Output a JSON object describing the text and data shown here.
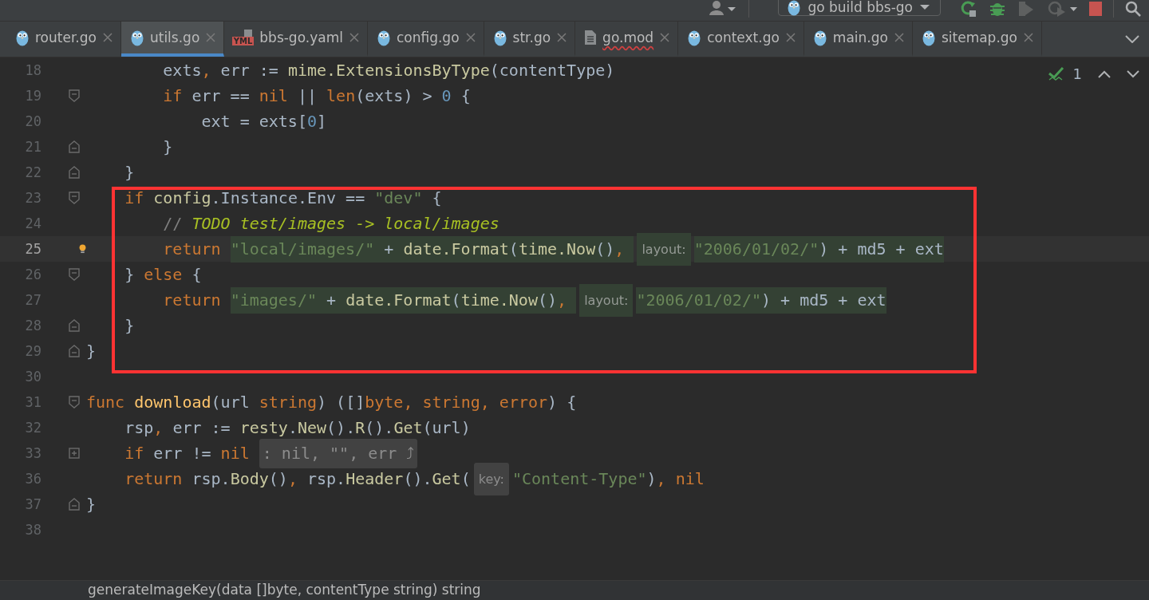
{
  "toolbar": {
    "run_config": "go build bbs-go"
  },
  "tabs": [
    {
      "label": "router.go",
      "kind": "go",
      "selected": false,
      "error": false
    },
    {
      "label": "utils.go",
      "kind": "go",
      "selected": true,
      "error": false
    },
    {
      "label": "bbs-go.yaml",
      "kind": "yaml",
      "icon_text": "YML",
      "selected": false,
      "error": false
    },
    {
      "label": "config.go",
      "kind": "go",
      "selected": false,
      "error": false
    },
    {
      "label": "str.go",
      "kind": "go",
      "selected": false,
      "error": false
    },
    {
      "label": "go.mod",
      "kind": "mod",
      "selected": false,
      "error": true
    },
    {
      "label": "context.go",
      "kind": "go",
      "selected": false,
      "error": false
    },
    {
      "label": "main.go",
      "kind": "go",
      "selected": false,
      "error": false
    },
    {
      "label": "sitemap.go",
      "kind": "go",
      "selected": false,
      "error": false
    }
  ],
  "inspection": {
    "count": "1"
  },
  "lines": [
    {
      "number": "18",
      "current": false,
      "tokens": [
        {
          "kind": "id",
          "text": "        exts"
        },
        {
          "kind": "punct",
          "text": ", "
        },
        {
          "kind": "id",
          "text": "err := "
        },
        {
          "kind": "call",
          "text": "mime.ExtensionsByType"
        },
        {
          "kind": "id",
          "text": "(contentType)"
        }
      ]
    },
    {
      "number": "19",
      "current": false,
      "fold": {
        "kind": "open"
      },
      "tokens": [
        {
          "kind": "kw",
          "text": "        if "
        },
        {
          "kind": "id",
          "text": "err == "
        },
        {
          "kind": "kw",
          "text": "nil"
        },
        {
          "kind": "id",
          "text": " || "
        },
        {
          "kind": "kw",
          "text": "len"
        },
        {
          "kind": "id",
          "text": "(exts) > "
        },
        {
          "kind": "num",
          "text": "0"
        },
        {
          "kind": "id",
          "text": " {"
        }
      ]
    },
    {
      "number": "20",
      "current": false,
      "tokens": [
        {
          "kind": "id",
          "text": "            ext = exts["
        },
        {
          "kind": "num",
          "text": "0"
        },
        {
          "kind": "id",
          "text": "]"
        }
      ]
    },
    {
      "number": "21",
      "current": false,
      "fold": {
        "kind": "close"
      },
      "tokens": [
        {
          "kind": "id",
          "text": "        }"
        }
      ]
    },
    {
      "number": "22",
      "current": false,
      "fold": {
        "kind": "close"
      },
      "tokens": [
        {
          "kind": "id",
          "text": "    }"
        }
      ]
    },
    {
      "number": "23",
      "current": false,
      "fold": {
        "kind": "open"
      },
      "tokens": [
        {
          "kind": "kw",
          "text": "    if "
        },
        {
          "kind": "call",
          "text": "config"
        },
        {
          "kind": "id",
          "text": ".Instance.Env == "
        },
        {
          "kind": "str",
          "text": "\"dev\""
        },
        {
          "kind": "id",
          "text": " {"
        }
      ]
    },
    {
      "number": "24",
      "current": false,
      "tokens": [
        {
          "kind": "cmt",
          "text": "        // "
        },
        {
          "kind": "todo",
          "text": "TODO test/images -> local/images"
        }
      ]
    },
    {
      "number": "25",
      "current": true,
      "bulb": true,
      "tokens": [
        {
          "kind": "kw",
          "text": "        return "
        },
        {
          "kind": "str",
          "text": "\"local/images/\"",
          "marked": true
        },
        {
          "kind": "id",
          "text": " + ",
          "marked": true
        },
        {
          "kind": "call",
          "text": "date.Format",
          "marked": true
        },
        {
          "kind": "id",
          "text": "(",
          "marked": true
        },
        {
          "kind": "call",
          "text": "time.Now",
          "marked": true
        },
        {
          "kind": "id",
          "text": "()",
          "marked": true
        },
        {
          "kind": "punct",
          "text": ", ",
          "marked": true
        },
        {
          "kind": "hint",
          "text": "layout:",
          "marked": true
        },
        {
          "kind": "str",
          "text": "\"2006/01/02/\"",
          "marked": true
        },
        {
          "kind": "id",
          "text": ") + md5 + ext",
          "marked": true
        }
      ]
    },
    {
      "number": "26",
      "current": false,
      "fold": {
        "kind": "open"
      },
      "tokens": [
        {
          "kind": "id",
          "text": "    } "
        },
        {
          "kind": "kw",
          "text": "else"
        },
        {
          "kind": "id",
          "text": " {"
        }
      ]
    },
    {
      "number": "27",
      "current": false,
      "tokens": [
        {
          "kind": "kw",
          "text": "        return "
        },
        {
          "kind": "str",
          "text": "\"images/\"",
          "marked": true
        },
        {
          "kind": "id",
          "text": " + ",
          "marked": true
        },
        {
          "kind": "call",
          "text": "date.Format",
          "marked": true
        },
        {
          "kind": "id",
          "text": "(",
          "marked": true
        },
        {
          "kind": "call",
          "text": "time.Now",
          "marked": true
        },
        {
          "kind": "id",
          "text": "()",
          "marked": true
        },
        {
          "kind": "punct",
          "text": ", ",
          "marked": true
        },
        {
          "kind": "hint",
          "text": "layout:",
          "marked": true
        },
        {
          "kind": "str",
          "text": "\"2006/01/02/\"",
          "marked": true
        },
        {
          "kind": "id",
          "text": ") + md5 + ext",
          "marked": true
        }
      ]
    },
    {
      "number": "28",
      "current": false,
      "fold": {
        "kind": "close"
      },
      "tokens": [
        {
          "kind": "id",
          "text": "    }"
        }
      ]
    },
    {
      "number": "29",
      "current": false,
      "fold": {
        "kind": "close"
      },
      "tokens": [
        {
          "kind": "id",
          "text": "}"
        }
      ]
    },
    {
      "number": "30",
      "current": false
    },
    {
      "number": "31",
      "current": false,
      "fold": {
        "kind": "open"
      },
      "tokens": [
        {
          "kind": "kw",
          "text": "func "
        },
        {
          "kind": "fn",
          "text": "download"
        },
        {
          "kind": "id",
          "text": "(url "
        },
        {
          "kind": "kw",
          "text": "string"
        },
        {
          "kind": "id",
          "text": ") ([]"
        },
        {
          "kind": "kw",
          "text": "byte"
        },
        {
          "kind": "punct",
          "text": ", "
        },
        {
          "kind": "kw",
          "text": "string"
        },
        {
          "kind": "punct",
          "text": ", "
        },
        {
          "kind": "kw",
          "text": "error"
        },
        {
          "kind": "id",
          "text": ") {"
        }
      ]
    },
    {
      "number": "32",
      "current": false,
      "tokens": [
        {
          "kind": "id",
          "text": "    rsp"
        },
        {
          "kind": "punct",
          "text": ", "
        },
        {
          "kind": "id",
          "text": "err := "
        },
        {
          "kind": "call",
          "text": "resty"
        },
        {
          "kind": "id",
          "text": "."
        },
        {
          "kind": "call",
          "text": "New"
        },
        {
          "kind": "id",
          "text": "()."
        },
        {
          "kind": "call",
          "text": "R"
        },
        {
          "kind": "id",
          "text": "()."
        },
        {
          "kind": "call",
          "text": "Get"
        },
        {
          "kind": "id",
          "text": "(url)"
        }
      ]
    },
    {
      "number": "33",
      "current": false,
      "fold": {
        "kind": "collapsed"
      },
      "tokens": [
        {
          "kind": "kw",
          "text": "    if "
        },
        {
          "kind": "id",
          "text": "err != "
        },
        {
          "kind": "kw",
          "text": "nil "
        },
        {
          "kind": "chip",
          "text": ": nil, \"\", err ⤴"
        }
      ]
    },
    {
      "number": "36",
      "current": false,
      "tokens": [
        {
          "kind": "kw",
          "text": "    return "
        },
        {
          "kind": "id",
          "text": "rsp."
        },
        {
          "kind": "call",
          "text": "Body"
        },
        {
          "kind": "id",
          "text": "()"
        },
        {
          "kind": "punct",
          "text": ", "
        },
        {
          "kind": "id",
          "text": "rsp."
        },
        {
          "kind": "call",
          "text": "Header"
        },
        {
          "kind": "id",
          "text": "()."
        },
        {
          "kind": "call",
          "text": "Get"
        },
        {
          "kind": "id",
          "text": "("
        },
        {
          "kind": "hint",
          "text": "key:"
        },
        {
          "kind": "str",
          "text": "\"Content-Type\""
        },
        {
          "kind": "id",
          "text": ")"
        },
        {
          "kind": "punct",
          "text": ", "
        },
        {
          "kind": "kw",
          "text": "nil"
        }
      ]
    },
    {
      "number": "37",
      "current": false,
      "fold": {
        "kind": "close"
      },
      "tokens": [
        {
          "kind": "id",
          "text": "}"
        }
      ]
    },
    {
      "number": "38",
      "current": false
    }
  ],
  "status_bar": {
    "signature": "generateImageKey(data []byte, contentType string) string"
  }
}
